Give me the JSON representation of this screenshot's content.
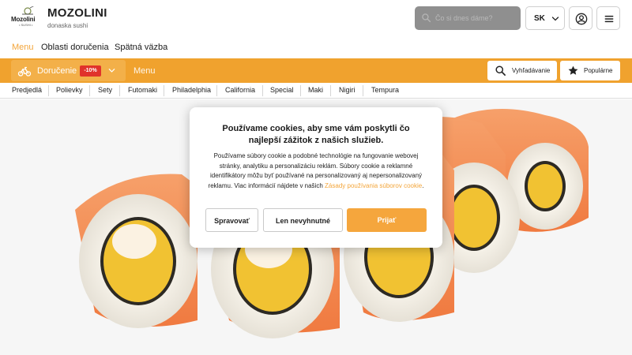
{
  "header": {
    "logo_text": "Mozolini",
    "logo_sub": "• SUSHI •",
    "brand": "MOZOLINI",
    "tagline": "donaska sushi",
    "search_placeholder": "Čo si dnes dáme?",
    "language": "SK"
  },
  "nav": {
    "items": [
      "Menu",
      "Oblasti doručenia",
      "Spätná väzba"
    ]
  },
  "order_bar": {
    "delivery_label": "Doručenie",
    "discount_badge": "-10%",
    "menu_label": "Menu",
    "search_label": "Vyhľadávanie",
    "popular_label": "Populárne",
    "accent_color": "#f0a22e"
  },
  "categories": [
    "Predjedlá",
    "Polievky",
    "Sety",
    "Futomaki",
    "Philadelphia",
    "California",
    "Special",
    "Maki",
    "Nigiri",
    "Tempura"
  ],
  "cookie_modal": {
    "title": "Používame cookies, aby sme vám poskytli čo najlepší zážitok z našich služieb.",
    "body": "Používame súbory cookie a podobné technológie na fungovanie webovej stránky, analytiku a personalizáciu reklám. Súbory cookie a reklamné identifikátory môžu byť používané na personalizovaný aj nepersonalizovaný reklamu. Viac informácií nájdete v našich",
    "link_text": "Zásady používania súborov cookie",
    "body_end": ".",
    "buttons": {
      "manage": "Spravovať",
      "necessary": "Len nevyhnutné",
      "accept": "Prijať"
    }
  }
}
